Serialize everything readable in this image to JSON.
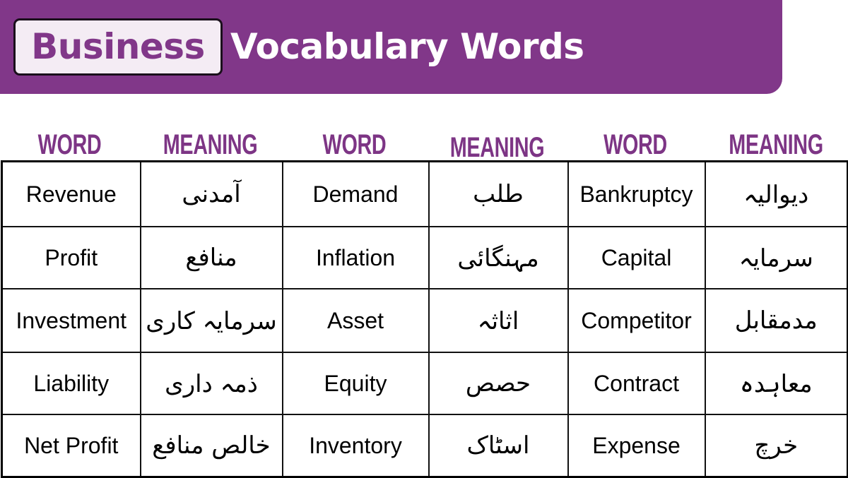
{
  "title": {
    "highlight": "Business",
    "rest": "Vocabulary Words"
  },
  "colors": {
    "brand_purple": "#813789",
    "highlight_bg": "#f4ecf4",
    "header_text": "#7d3585"
  },
  "table": {
    "headers": [
      "WORD",
      "MEANING",
      "WORD",
      "MEANING",
      "WORD",
      "MEANING"
    ],
    "rows": [
      [
        {
          "word": "Revenue",
          "meaning": "آمدنی"
        },
        {
          "word": "Demand",
          "meaning": "طلب"
        },
        {
          "word": "Bankruptcy",
          "meaning": "دیوالیہ"
        }
      ],
      [
        {
          "word": "Profit",
          "meaning": "منافع"
        },
        {
          "word": "Inflation",
          "meaning": "مہنگائی"
        },
        {
          "word": "Capital",
          "meaning": "سرمایہ"
        }
      ],
      [
        {
          "word": "Investment",
          "meaning": "سرمایہ کاری"
        },
        {
          "word": "Asset",
          "meaning": "اثاثہ"
        },
        {
          "word": "Competitor",
          "meaning": "مدمقابل"
        }
      ],
      [
        {
          "word": "Liability",
          "meaning": "ذمہ داری"
        },
        {
          "word": "Equity",
          "meaning": "حصص"
        },
        {
          "word": "Contract",
          "meaning": "معاہدہ"
        }
      ],
      [
        {
          "word": "Net Profit",
          "meaning": "خالص منافع"
        },
        {
          "word": "Inventory",
          "meaning": "اسٹاک"
        },
        {
          "word": "Expense",
          "meaning": "خرچ"
        }
      ]
    ]
  }
}
